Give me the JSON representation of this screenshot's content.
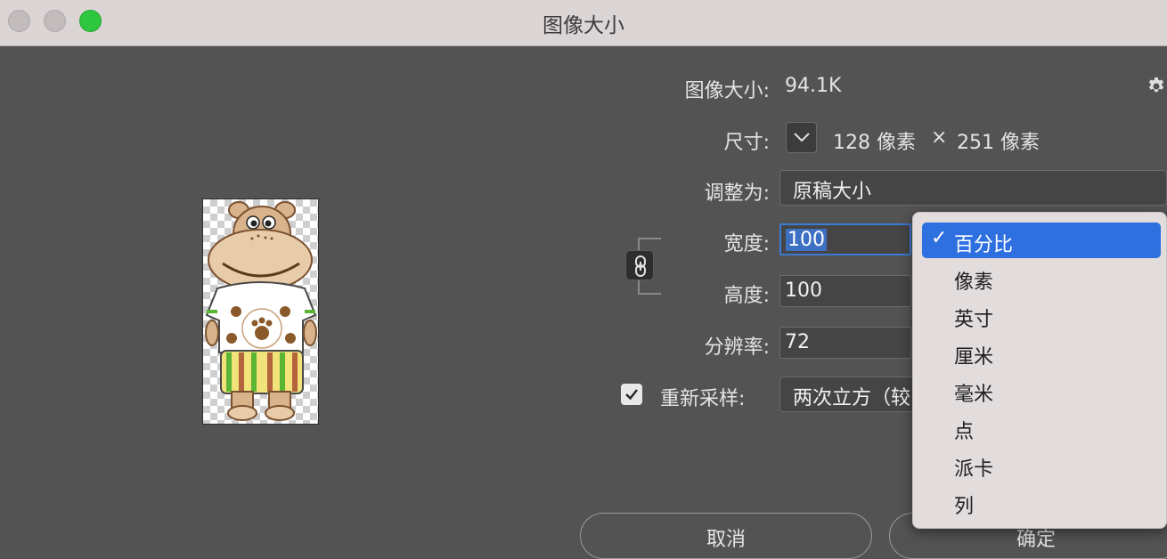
{
  "window": {
    "title": "图像大小"
  },
  "info": {
    "size_label": "图像大小:",
    "size_value": "94.1K"
  },
  "dimensions": {
    "label": "尺寸:",
    "width_value": "128 像素",
    "times": "×",
    "height_value": "251 像素"
  },
  "fit_to": {
    "label": "调整为:",
    "value": "原稿大小"
  },
  "width": {
    "label": "宽度:",
    "value": "100"
  },
  "height": {
    "label": "高度:",
    "value": "100"
  },
  "resolution": {
    "label": "分辨率:",
    "value": "72"
  },
  "resample": {
    "label": "重新采样:",
    "value": "两次立方（较",
    "checked": true
  },
  "buttons": {
    "cancel": "取消",
    "ok": "确定"
  },
  "unit_menu": {
    "items": [
      {
        "label": "百分比",
        "selected": true
      },
      {
        "label": "像素",
        "selected": false
      },
      {
        "label": "英寸",
        "selected": false
      },
      {
        "label": "厘米",
        "selected": false
      },
      {
        "label": "毫米",
        "selected": false
      },
      {
        "label": "点",
        "selected": false
      },
      {
        "label": "派卡",
        "selected": false
      },
      {
        "label": "列",
        "selected": false
      }
    ],
    "check_glyph": "✓"
  },
  "icons": {
    "gear": "gear-icon",
    "chevron": "chevron-down-icon",
    "link": "link-icon",
    "checkbox": "checkmark-icon"
  },
  "colors": {
    "accent": "#2f70e0",
    "background": "#535353",
    "titlebar": "#dcd5d6"
  }
}
